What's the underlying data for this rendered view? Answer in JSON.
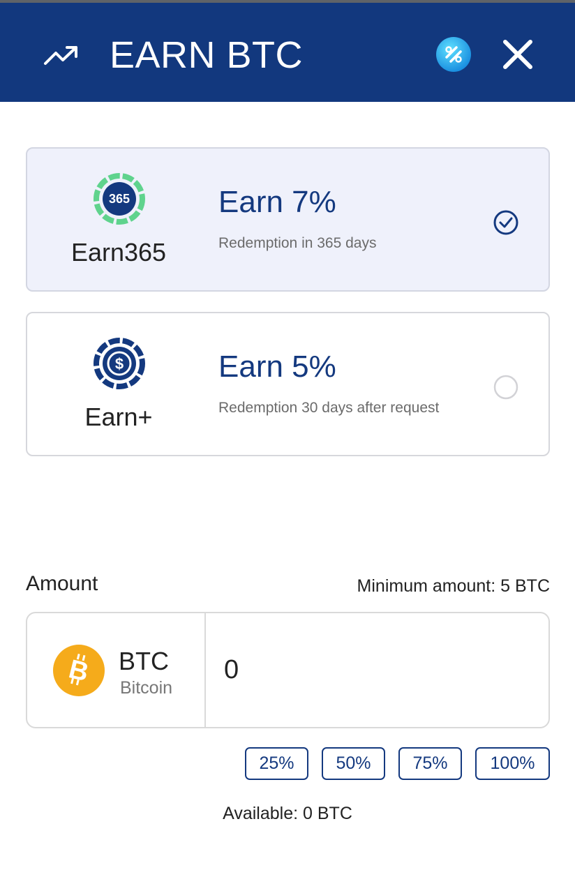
{
  "header": {
    "title": "EARN BTC",
    "background_color": "#12387e",
    "icons": [
      "trending-up-icon",
      "percent-icon",
      "close-icon"
    ]
  },
  "plans": [
    {
      "name": "Earn365",
      "badge_text": "365",
      "rate": "Earn 7%",
      "description": "Redemption in 365 days",
      "selected": true,
      "icon": "earn365-badge-icon"
    },
    {
      "name": "Earn+",
      "rate": "Earn 5%",
      "description": "Redemption 30 days after request",
      "selected": false,
      "icon": "dollar-coin-icon"
    }
  ],
  "amount": {
    "label": "Amount",
    "minimum": "Minimum amount: 5 BTC",
    "coin_symbol": "BTC",
    "coin_name": "Bitcoin",
    "coin_icon": "bitcoin-icon",
    "value": "0",
    "available": "Available: 0 BTC"
  },
  "percent_buttons": [
    "25%",
    "50%",
    "75%",
    "100%"
  ],
  "colors": {
    "primary": "#14397f",
    "selected_card_bg": "#eff1fb",
    "accent_green": "#5fd38d",
    "bitcoin_orange": "#f5ab1b"
  }
}
